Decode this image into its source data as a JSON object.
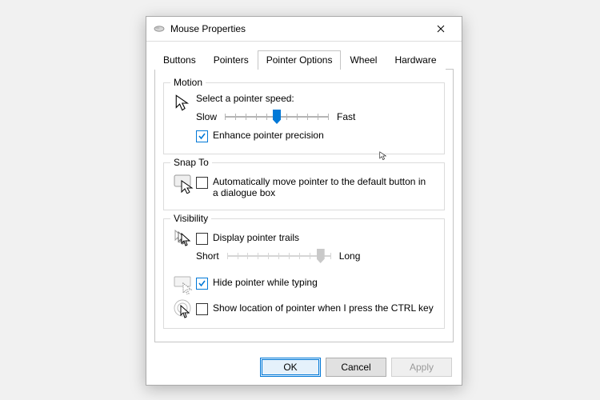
{
  "window": {
    "title": "Mouse Properties"
  },
  "tabs": {
    "items": [
      "Buttons",
      "Pointers",
      "Pointer Options",
      "Wheel",
      "Hardware"
    ],
    "active_index": 2
  },
  "motion": {
    "legend": "Motion",
    "label": "Select a pointer speed:",
    "slow": "Slow",
    "fast": "Fast",
    "speed_index": 5,
    "speed_steps": 11,
    "enhance_label": "Enhance pointer precision",
    "enhance_checked": true
  },
  "snap": {
    "legend": "Snap To",
    "auto_label": "Automatically move pointer to the default button in a dialogue box",
    "auto_checked": false
  },
  "visibility": {
    "legend": "Visibility",
    "trails_label": "Display pointer trails",
    "trails_checked": false,
    "trails_enabled": false,
    "short": "Short",
    "long": "Long",
    "trail_index": 9,
    "trail_steps": 11,
    "hide_label": "Hide pointer while typing",
    "hide_checked": true,
    "ctrl_label": "Show location of pointer when I press the CTRL key",
    "ctrl_checked": false
  },
  "buttons": {
    "ok": "OK",
    "cancel": "Cancel",
    "apply": "Apply"
  }
}
